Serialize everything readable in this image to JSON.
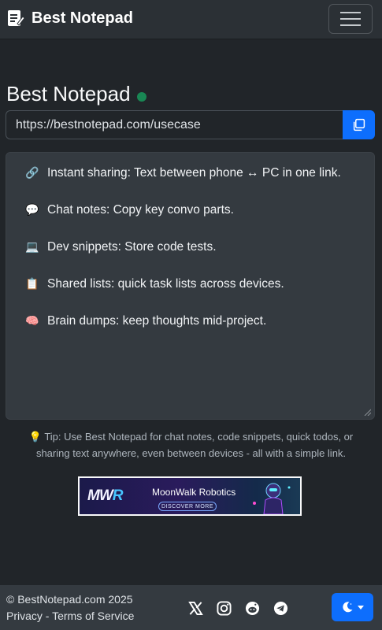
{
  "navbar": {
    "brand": "Best Notepad",
    "brand_icon": "notepad-pencil-icon",
    "menu_icon": "hamburger-icon"
  },
  "main": {
    "title": "Best Notepad",
    "status_color": "#198754",
    "url_value": "https://bestnotepad.com/usecase",
    "copy_icon": "copy-icon",
    "note_lines": [
      {
        "emoji": "🔗",
        "text": "Instant sharing: Text between phone ↔ PC in one link."
      },
      {
        "emoji": "💬",
        "text": "Chat notes: Copy key convo parts."
      },
      {
        "emoji": "💻",
        "text": "Dev snippets: Store code tests."
      },
      {
        "emoji": "📋",
        "text": "Shared lists: quick task lists across devices."
      },
      {
        "emoji": "🧠",
        "text": "Brain dumps: keep thoughts mid-project."
      }
    ],
    "tip_icon": "💡",
    "tip": "Tip: Use Best Notepad for chat notes, code snippets, quick todos, or sharing text anywhere, even between devices - all with a simple link."
  },
  "ad": {
    "logo_a": "MW",
    "logo_b": "R",
    "name": "MoonWalk Robotics",
    "cta": "DISCOVER MORE"
  },
  "footer": {
    "copyright": "© BestNotepad.com 2025",
    "privacy": "Privacy",
    "separator": "-",
    "terms": "Terms of Service",
    "socials": [
      "x-icon",
      "instagram-icon",
      "reddit-icon",
      "telegram-icon"
    ],
    "theme_icon": "moon-icon"
  },
  "colors": {
    "accent": "#0d6efd",
    "background": "#212529",
    "surface": "#343a40"
  }
}
